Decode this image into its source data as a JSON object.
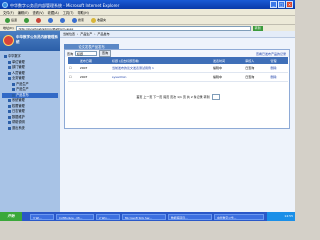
{
  "window": {
    "title": "中华数字公务员内部管理系统 - Microsoft Internet Explorer"
  },
  "menu": [
    "文件(F)",
    "编辑(E)",
    "查看(V)",
    "收藏(A)",
    "工具(T)",
    "帮助(H)"
  ],
  "toolbar": {
    "back": "后退",
    "forward": "",
    "stop": "",
    "refresh": "",
    "home": "",
    "search": "搜索",
    "favorites": "收藏夹"
  },
  "address": {
    "label": "地址(D)",
    "url": "http://localhost/admin/Platform.aspx",
    "go": "转到"
  },
  "sidebar": {
    "system_name": "中华数字公务员内部管理系统",
    "items": [
      {
        "label": "中华数字",
        "level": 1
      },
      {
        "label": "单位管理",
        "level": 2
      },
      {
        "label": "部门管理",
        "level": 2
      },
      {
        "label": "人员管理",
        "level": 2
      },
      {
        "label": "业务管理",
        "level": 2
      },
      {
        "label": "产品生产",
        "level": 3
      },
      {
        "label": "产品生产",
        "level": 3
      },
      {
        "label": "产品发布",
        "level": 3
      },
      {
        "label": "系统管理",
        "level": 2
      },
      {
        "label": "权限管理",
        "level": 2
      },
      {
        "label": "日志管理",
        "level": 2
      },
      {
        "label": "数据维护",
        "level": 2
      },
      {
        "label": "帮助说明",
        "level": 2
      },
      {
        "label": "退出系统",
        "level": 2
      }
    ]
  },
  "main": {
    "breadcrumb": [
      "当前位置",
      "产品生产",
      "产品发布"
    ],
    "tab": "论文发表产品发布",
    "filter": {
      "label": "查询",
      "select": "标题",
      "button": "查询",
      "right_link": "查看已发布产品的记录"
    },
    "table": {
      "headers": [
        "",
        "发布日期",
        "标题 (点击标题查看)",
        "发表时间",
        "审核人",
        "管理"
      ],
      "rows": [
        [
          "",
          "2007",
          "当前发布的论文发表测试用例 1",
          "编辑中",
          "日查询",
          "删除"
        ],
        [
          "",
          "2007",
          "sysadmin",
          "编辑中",
          "日查询",
          "删除"
        ]
      ]
    },
    "pager": "首页 上一页 下一页 尾页 页次 1/1 页 共 2 条记录 转到"
  },
  "taskbar": {
    "start": "开始",
    "tasks": [
      "3 Wi...",
      "CxfModule - Mi...",
      "2 Win...",
      "Microsoft SQL Ser...",
      "数据库项目...",
      "中华数字公务..."
    ],
    "time": "14:55"
  }
}
